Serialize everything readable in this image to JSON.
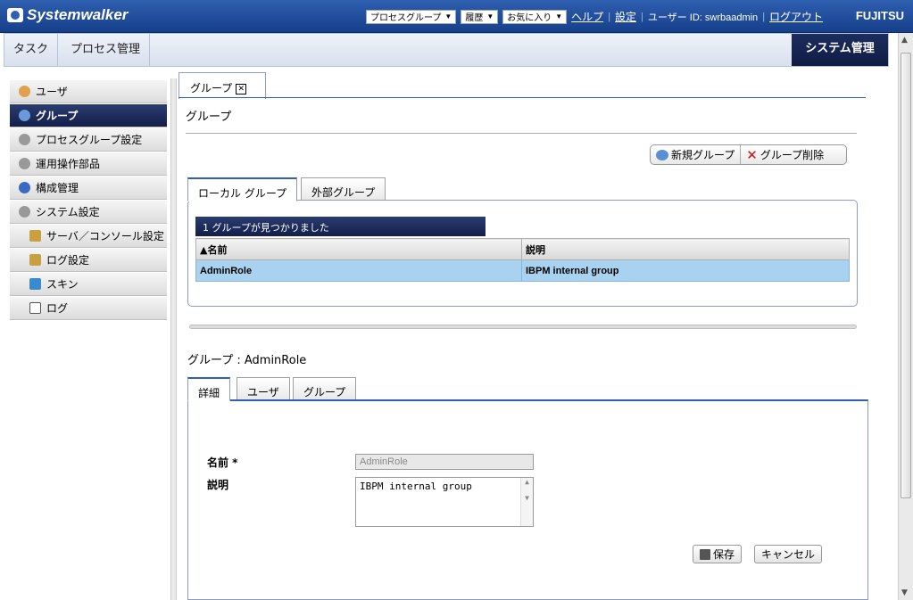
{
  "header": {
    "logo": "Systemwalker",
    "process_group": "プロセスグループ",
    "history": "履歴",
    "favorites": "お気に入り",
    "help": "ヘルプ",
    "settings": "設定",
    "user_label": "ユーザー ID: swrbaadmin",
    "logout": "ログアウト",
    "brand": "FUJITSU"
  },
  "nav": {
    "task": "タスク",
    "process_mgmt": "プロセス管理",
    "system_mgmt": "システム管理"
  },
  "sidebar": {
    "items": [
      {
        "label": "ユーザ"
      },
      {
        "label": "グループ"
      },
      {
        "label": "プロセスグループ設定"
      },
      {
        "label": "運用操作部品"
      },
      {
        "label": "構成管理"
      },
      {
        "label": "システム設定"
      },
      {
        "label": "サーバ／コンソール設定"
      },
      {
        "label": "ログ設定"
      },
      {
        "label": "スキン"
      },
      {
        "label": "ログ"
      }
    ]
  },
  "main": {
    "tab_label": "グループ",
    "heading": "グループ",
    "new_group": "新規グループ",
    "delete_group": "グループ削除",
    "local_tab": "ローカル グループ",
    "external_tab": "外部グループ",
    "found_text": "1 グループが見つかりました",
    "columns": [
      "名前",
      "説明"
    ],
    "rows": [
      {
        "name": "AdminRole",
        "description": "IBPM internal group"
      }
    ],
    "detail_heading": "グループ : AdminRole",
    "detail_tabs": [
      "詳細",
      "ユーザ",
      "グループ"
    ],
    "name_label": "名前 *",
    "desc_label": "説明",
    "name_value": "AdminRole",
    "desc_value": "IBPM internal group",
    "save": "保存",
    "cancel": "キャンセル"
  }
}
